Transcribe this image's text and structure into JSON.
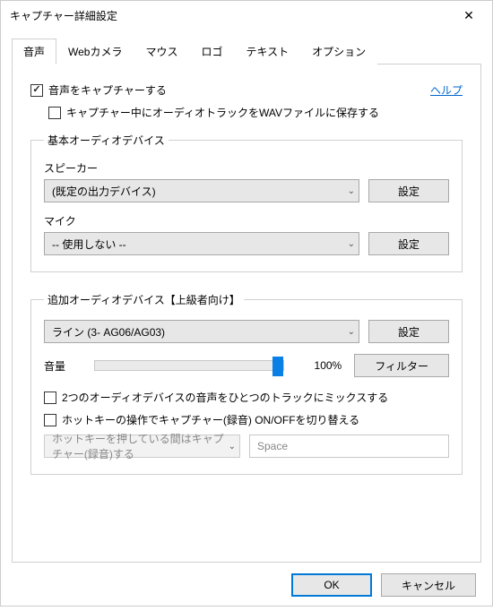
{
  "window": {
    "title": "キャプチャー詳細設定"
  },
  "tabs": {
    "audio": "音声",
    "webcam": "Webカメラ",
    "mouse": "マウス",
    "logo": "ロゴ",
    "text": "テキスト",
    "option": "オプション"
  },
  "audio_tab": {
    "capture_audio": "音声をキャプチャーする",
    "help": "ヘルプ",
    "save_wav": "キャプチャー中にオーディオトラックをWAVファイルに保存する",
    "basic": {
      "legend": "基本オーディオデバイス",
      "speaker_label": "スピーカー",
      "speaker_value": "(既定の出力デバイス)",
      "speaker_settings": "設定",
      "mic_label": "マイク",
      "mic_value": "-- 使用しない --",
      "mic_settings": "設定"
    },
    "advanced": {
      "legend": "追加オーディオデバイス【上級者向け】",
      "device_value": "ライン (3- AG06/AG03)",
      "device_settings": "設定",
      "volume_label": "音量",
      "volume_value": "100%",
      "filter": "フィルター",
      "mix_tracks": "2つのオーディオデバイスの音声をひとつのトラックにミックスする",
      "hotkey_toggle": "ホットキーの操作でキャプチャー(録音) ON/OFFを切り替える",
      "hotkey_mode_value": "ホットキーを押している間はキャプチャー(録音)する",
      "hotkey_key": "Space"
    }
  },
  "footer": {
    "ok": "OK",
    "cancel": "キャンセル"
  }
}
